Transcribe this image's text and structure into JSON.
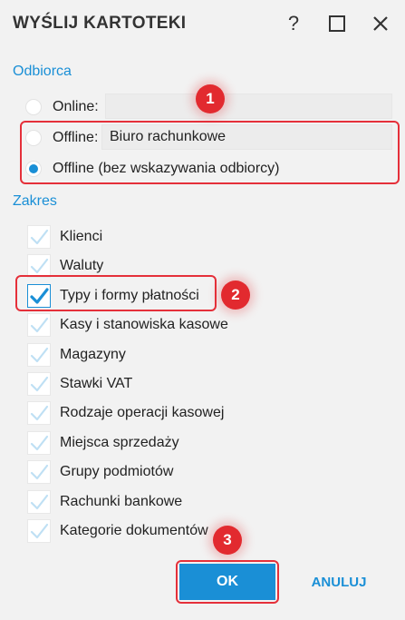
{
  "window": {
    "title": "WYŚLIJ KARTOTEKI",
    "help_icon": "question-mark-icon",
    "maximize_icon": "maximize-icon",
    "close_icon": "close-icon"
  },
  "recipient": {
    "section_label": "Odbiorca",
    "options": [
      {
        "label": "Online:",
        "field_value": "",
        "checked": false
      },
      {
        "label": "Offline:",
        "field_value": "Biuro rachunkowe",
        "checked": false
      },
      {
        "label": "Offline (bez wskazywania odbiorcy)",
        "checked": true
      }
    ]
  },
  "scope": {
    "section_label": "Zakres",
    "items": [
      {
        "label": "Klienci",
        "checked": true
      },
      {
        "label": "Waluty",
        "checked": true
      },
      {
        "label": "Typy i formy płatności",
        "checked": true
      },
      {
        "label": "Kasy i stanowiska kasowe",
        "checked": true
      },
      {
        "label": "Magazyny",
        "checked": true
      },
      {
        "label": "Stawki VAT",
        "checked": true
      },
      {
        "label": "Rodzaje operacji kasowej",
        "checked": true
      },
      {
        "label": "Miejsca sprzedaży",
        "checked": true
      },
      {
        "label": "Grupy podmiotów",
        "checked": true
      },
      {
        "label": "Rachunki bankowe",
        "checked": true
      },
      {
        "label": "Kategorie dokumentów",
        "checked": true
      }
    ]
  },
  "callouts": [
    "1",
    "2",
    "3"
  ],
  "buttons": {
    "ok": "OK",
    "cancel": "ANULUJ"
  },
  "colors": {
    "accent": "#1a8fd6",
    "highlight": "#e5303a",
    "badge": "#e22a2f"
  }
}
